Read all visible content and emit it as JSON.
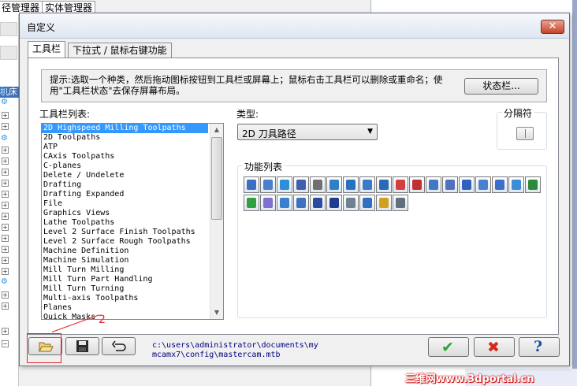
{
  "background": {
    "tabs": [
      "径管理器",
      "实体管理器"
    ],
    "machine_label": "机床"
  },
  "dialog": {
    "title": "自定义",
    "tabs": [
      {
        "label": "工具栏",
        "active": true
      },
      {
        "label": "下拉式 / 鼠标右键功能",
        "active": false
      }
    ],
    "hint": "提示:选取一个种类，然后拖动图标按钮到工具栏或屏幕上；鼠标右击工具栏可以删除或重命名；使用\"工具栏状态\"去保存屏幕布局。",
    "status_button": "状态栏...",
    "toolbar_list_label": "工具栏列表:",
    "toolbar_list": [
      "2D Highspeed Milling Toolpaths",
      "2D Toolpaths",
      "ATP",
      "CAxis Toolpaths",
      "C-planes",
      "Delete / Undelete",
      "Drafting",
      "Drafting Expanded",
      "File",
      "Graphics Views",
      "Lathe Toolpaths",
      "Level 2 Surface Finish Toolpaths",
      "Level 2 Surface Rough Toolpaths",
      "Machine Definition",
      "Machine Simulation",
      "Mill Turn Milling",
      "Mill Turn Part Handling",
      "Mill Turn Turning",
      "Multi-axis Toolpaths",
      "Planes",
      "Quick Masks"
    ],
    "selected_index": 0,
    "category_label": "类型:",
    "category_value": "2D 刀具路径",
    "separator_label": "分隔符",
    "function_list_label": "功能列表",
    "function_icons": [
      "contour-icon",
      "pocket-icon",
      "face-icon",
      "slot-icon",
      "drill-icon",
      "pocket-island-icon",
      "pocket-open-icon",
      "pocket-remachine-icon",
      "facing-icon",
      "engrave-icon",
      "chamfer-icon",
      "circle-mill-icon",
      "thread-mill-icon",
      "helix-bore-icon",
      "point-icon",
      "transform-icon",
      "multi-pass-icon",
      "trim-icon",
      "mesh-pocket-icon",
      "solid-icon",
      "dynamic-mill-icon",
      "area-mill-icon",
      "core-mill-icon",
      "peel-mill-icon",
      "block-drill-icon",
      "model-chamfer-icon",
      "feature-icon",
      "machine-icon"
    ],
    "function_icon_colors": [
      "#3a6fc4",
      "#4a7fd0",
      "#2d8fd8",
      "#4060b0",
      "#707070",
      "#3080c8",
      "#2a70c0",
      "#3a7ac8",
      "#2a6ab8",
      "#d04040",
      "#c03030",
      "#4078c8",
      "#5070c0",
      "#3060c0",
      "#4a80d0",
      "#3a70c8",
      "#3c8cd8",
      "#2a8a3a",
      "#30a040",
      "#8070d0",
      "#3a80d0",
      "#4070c0",
      "#2a4aa0",
      "#203c90",
      "#708090",
      "#3070c0",
      "#d0a020",
      "#607080"
    ],
    "path_line1": "c:\\users\\administrator\\documents\\my",
    "path_line2": "mcamx7\\config\\mastercam.mtb",
    "annotation_number": "2",
    "close_glyph": "✕",
    "ok_glyph": "✔",
    "cancel_glyph": "✖",
    "help_glyph": "?"
  },
  "watermark": "三维网www.3dportal.cn"
}
